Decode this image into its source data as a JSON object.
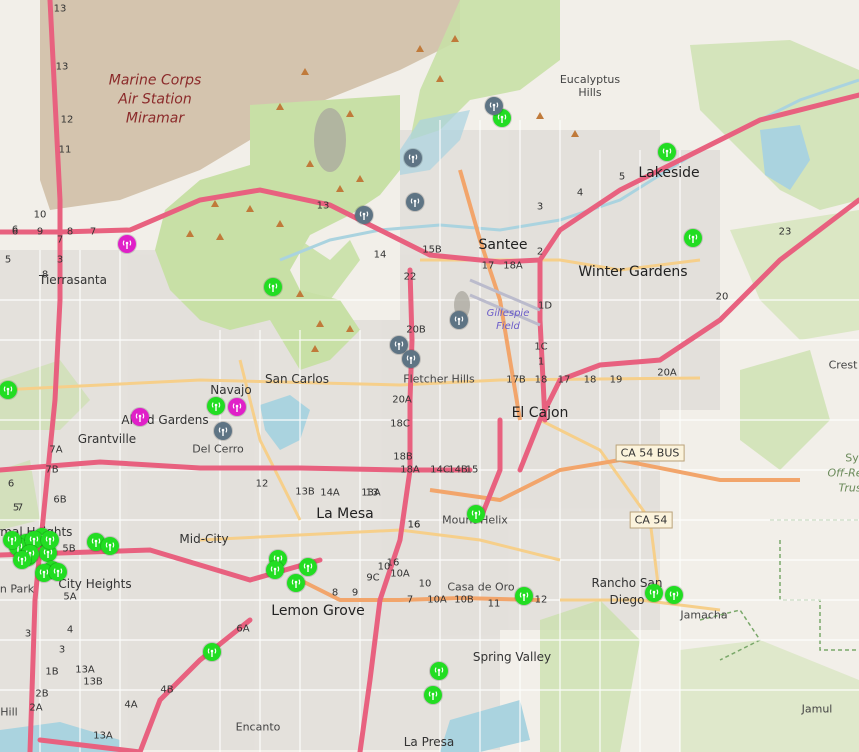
{
  "map": {
    "colors": {
      "land": "#f2efe9",
      "military": "#c9b69a",
      "park": "#c8e0a6",
      "water": "#aad3df",
      "motorway": "#e8617f",
      "trunk": "#f2a56b",
      "primary": "#f6cf8a",
      "minor": "#ffffff",
      "marker_green": "#22dd22",
      "marker_magenta": "#e020c8",
      "marker_gray": "#5e7484"
    },
    "labels": {
      "marine": "Marine Corps Air Station Miramar",
      "eucalyptus": "Eucalyptus Hills",
      "lakeside": "Lakeside",
      "santee": "Santee",
      "winter_gardens": "Winter Gardens",
      "gillespie": "Gillespie Field",
      "tierrasanta": "Tierrasanta",
      "san_carlos": "San Carlos",
      "navajo": "Navajo",
      "allied_gardens": "Allied Gardens",
      "grantville": "Grantville",
      "del_cerro": "Del Cerro",
      "fletcher_hills": "Fletcher Hills",
      "el_cajon": "El Cajon",
      "crest": "Crest",
      "la_mesa": "La Mesa",
      "mount_helix": "Mount Helix",
      "mid_city": "Mid-City",
      "normal_heights": "rmal Heights",
      "city_heights": "City Heights",
      "park": "n Park",
      "lemon_grove": "Lemon Grove",
      "casa_de_oro": "Casa de Oro",
      "rancho_san_diego": "Rancho San Diego",
      "jamacha": "Jamacha",
      "spring_valley": "Spring Valley",
      "encanto": "Encanto",
      "la_presa": "La Presa",
      "jamul": "Jamul",
      "hill": "Hill",
      "sy": "Sy",
      "off_re": "Off-Re",
      "trus": "Trus"
    },
    "shields": {
      "ca54bus": "CA 54 BUS",
      "ca54": "CA 54"
    },
    "route_numbers": [
      "13",
      "13",
      "12",
      "11",
      "10",
      "9",
      "8",
      "7",
      "6",
      "7",
      "8",
      "6",
      "5",
      "3",
      "13",
      "14",
      "15B",
      "17",
      "18A",
      "2",
      "22",
      "23",
      "20",
      "5",
      "4",
      "3",
      "1D",
      "1C",
      "1",
      "17B",
      "18",
      "17",
      "18",
      "19",
      "20A",
      "20B",
      "20A",
      "18C",
      "18B",
      "18A",
      "14C",
      "14B",
      "15",
      "16",
      "14A",
      "13",
      "13A",
      "13B",
      "12",
      "16",
      "16",
      "10A",
      "10",
      "9C",
      "9",
      "8",
      "7",
      "10",
      "10A",
      "10B",
      "11",
      "12",
      "7A",
      "7B",
      "6B",
      "5B",
      "5A",
      "4",
      "3",
      "1B",
      "13A",
      "13B",
      "2B",
      "2A",
      "4A",
      "4B",
      "13A",
      "5",
      "6",
      "6A",
      "7",
      "3"
    ],
    "markers": [
      {
        "color": "green"
      },
      {
        "color": "gray"
      },
      {
        "color": "gray"
      },
      {
        "color": "gray"
      },
      {
        "color": "gray"
      },
      {
        "color": "green"
      },
      {
        "color": "green"
      },
      {
        "color": "magenta"
      },
      {
        "color": "green"
      },
      {
        "color": "gray"
      },
      {
        "color": "gray"
      },
      {
        "color": "gray"
      },
      {
        "color": "green"
      },
      {
        "color": "magenta"
      },
      {
        "color": "green"
      },
      {
        "color": "magenta"
      },
      {
        "color": "gray"
      },
      {
        "color": "green"
      },
      {
        "color": "green"
      },
      {
        "color": "green"
      },
      {
        "color": "green"
      },
      {
        "color": "green"
      },
      {
        "color": "green"
      },
      {
        "color": "green"
      },
      {
        "color": "green"
      },
      {
        "color": "green"
      },
      {
        "color": "green"
      },
      {
        "color": "green"
      },
      {
        "color": "green"
      },
      {
        "color": "green"
      },
      {
        "color": "green"
      },
      {
        "color": "green"
      },
      {
        "color": "green"
      },
      {
        "color": "green"
      },
      {
        "color": "green"
      },
      {
        "color": "green"
      },
      {
        "color": "green"
      },
      {
        "color": "green"
      },
      {
        "color": "green"
      },
      {
        "color": "green"
      },
      {
        "color": "green"
      },
      {
        "color": "green"
      },
      {
        "color": "green"
      }
    ]
  }
}
